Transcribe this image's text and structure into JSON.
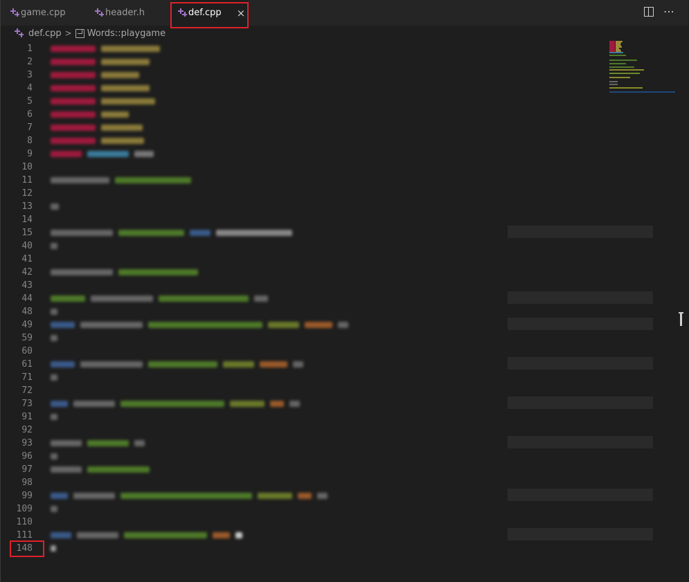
{
  "tabs": [
    {
      "label": "game.cpp",
      "icon": "cpp-file-icon",
      "active": false
    },
    {
      "label": "header.h",
      "icon": "cpp-file-icon",
      "active": false
    },
    {
      "label": "def.cpp",
      "icon": "cpp-file-icon",
      "active": true,
      "close": "×"
    }
  ],
  "tab_actions": {
    "split_editor": "split-editor-icon",
    "more": "⋯"
  },
  "breadcrumb": {
    "file": "def.cpp",
    "symbol": "Words::playgame"
  },
  "line_numbers": [
    "1",
    "2",
    "3",
    "4",
    "5",
    "6",
    "7",
    "8",
    "9",
    "10",
    "11",
    "12",
    "13",
    "14",
    "15",
    "40",
    "41",
    "42",
    "43",
    "44",
    "48",
    "49",
    "59",
    "60",
    "61",
    "71",
    "72",
    "73",
    "91",
    "92",
    "93",
    "96",
    "97",
    "98",
    "99",
    "109",
    "110",
    "111",
    "148"
  ],
  "colors": {
    "accent_red": "#e0202a",
    "cpp_icon": "#a074c4",
    "background": "#1e1e1e"
  }
}
